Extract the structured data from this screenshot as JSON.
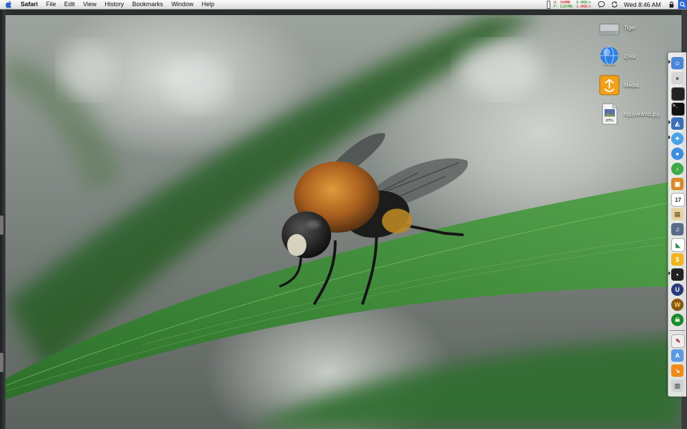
{
  "menubar": {
    "app": "Safari",
    "items": [
      "File",
      "Edit",
      "View",
      "History",
      "Bookmarks",
      "Window",
      "Help"
    ],
    "status": {
      "mem_used": "U: 349MB",
      "mem_free": "F: 1187MB",
      "net_in": "0.0KB/s",
      "net_out": "1.6KB/s",
      "clock": "Wed 8:46 AM"
    }
  },
  "desktop_icons": [
    {
      "label": "Tiger",
      "icon": "hard-drive-icon"
    },
    {
      "label": "iDisk",
      "icon": "idisk-globe-icon"
    },
    {
      "label": "Media",
      "icon": "firewire-drive-icon"
    },
    {
      "label": "nguyenlmd.jpg",
      "icon": "jpeg-file-icon"
    }
  ],
  "jpeg_badge": "JPEG",
  "dock": {
    "calendar_day": "17",
    "items": [
      "finder",
      "apple",
      "terminal-1",
      "terminal-2",
      "preview",
      "safari",
      "ichat",
      "itunes",
      "photo",
      "ical",
      "ebook",
      "guitar",
      "mail",
      "dollar",
      "console",
      "unreal",
      "warcraft",
      "scum",
      "documents",
      "applications",
      "downloads",
      "trash"
    ]
  },
  "colors": {
    "leaf": "#3f8a3a",
    "leaf_highlight": "#6cb35f",
    "accent": "#2b68d6"
  }
}
